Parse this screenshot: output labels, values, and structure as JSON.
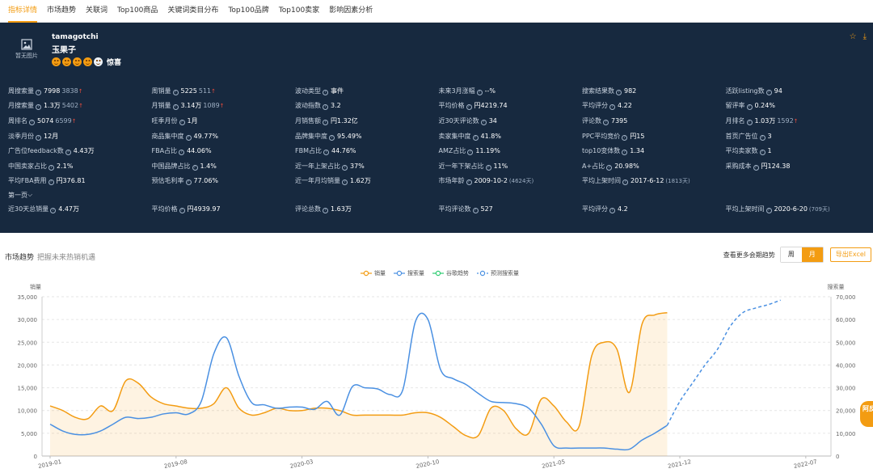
{
  "tabs": [
    "指标详情",
    "市场趋势",
    "关联词",
    "Top100商品",
    "关键词类目分布",
    "Top100品牌",
    "Top100卖家",
    "影响因素分析"
  ],
  "product": {
    "thumb_label": "暂无图片",
    "title": "tamagotchi",
    "subtitle": "玉果子",
    "emoji_text": "惊喜"
  },
  "metrics": [
    [
      {
        "label": "周搜索量",
        "value": "7998",
        "sub": "3838",
        "arrow": "↑"
      },
      {
        "label": "周销量",
        "value": "5225",
        "sub": "511",
        "arrow": "↑"
      },
      {
        "label": "波动类型",
        "value": "事件"
      },
      {
        "label": "未来3月涨幅",
        "value": "--%"
      },
      {
        "label": "搜索结果数",
        "value": "982"
      },
      {
        "label": "活跃listing数",
        "value": "94"
      }
    ],
    [
      {
        "label": "月搜索量",
        "value": "1.3万",
        "sub": "5402",
        "arrow": "↑"
      },
      {
        "label": "月销量",
        "value": "3.14万",
        "sub": "1089",
        "arrow": "↑"
      },
      {
        "label": "波动指数",
        "value": "3.2"
      },
      {
        "label": "平均价格",
        "value": "円4219.74"
      },
      {
        "label": "平均评分",
        "value": "4.22"
      },
      {
        "label": "留评率",
        "value": "0.24%"
      }
    ],
    [
      {
        "label": "周排名",
        "value": "5074",
        "sub": "6599",
        "arrow": "↑"
      },
      {
        "label": "旺季月份",
        "value": "1月"
      },
      {
        "label": "月销售额",
        "value": "円1.32亿"
      },
      {
        "label": "近30天评论数",
        "value": "34"
      },
      {
        "label": "评论数",
        "value": "7395"
      },
      {
        "label": "月排名",
        "value": "1.03万",
        "sub": "1592",
        "arrow": "↑"
      }
    ],
    [
      {
        "label": "淡季月份",
        "value": "12月"
      },
      {
        "label": "商品集中度",
        "value": "49.77%"
      },
      {
        "label": "品牌集中度",
        "value": "95.49%"
      },
      {
        "label": "卖家集中度",
        "value": "41.8%"
      },
      {
        "label": "PPC平均竞价",
        "value": "円15"
      },
      {
        "label": "首页广告位",
        "value": "3"
      }
    ],
    [
      {
        "label": "广告位feedback数",
        "value": "4.43万"
      },
      {
        "label": "FBA占比",
        "value": "44.06%"
      },
      {
        "label": "FBM占比",
        "value": "44.76%"
      },
      {
        "label": "AMZ占比",
        "value": "11.19%"
      },
      {
        "label": "top10变体数",
        "value": "1.34"
      },
      {
        "label": "平均卖家数",
        "value": "1"
      }
    ],
    [
      {
        "label": "中国卖家占比",
        "value": "2.1%"
      },
      {
        "label": "中国品牌占比",
        "value": "1.4%"
      },
      {
        "label": "近一年上架占比",
        "value": "37%"
      },
      {
        "label": "近一年下架占比",
        "value": "11%"
      },
      {
        "label": "A+占比",
        "value": "20.98%"
      },
      {
        "label": "采购成本",
        "value": "円124.38"
      }
    ],
    [
      {
        "label": "平均FBA费用",
        "value": "円376.81"
      },
      {
        "label": "预估毛利率",
        "value": "77.06%"
      },
      {
        "label": "近一年月均销量",
        "value": "1.62万"
      },
      {
        "label": "市场年龄",
        "value": "2009-10-2",
        "small": "(4624天)"
      },
      {
        "label": "平均上架时间",
        "value": "2017-6-12",
        "small": "(1813天)"
      },
      {
        "label": "",
        "value": ""
      }
    ]
  ],
  "page_toggle": "第一页",
  "last_row": [
    {
      "label": "近30天总销量",
      "value": "4.47万"
    },
    {
      "label": "平均价格",
      "value": "円4939.97"
    },
    {
      "label": "评论总数",
      "value": "1.63万"
    },
    {
      "label": "平均评论数",
      "value": "527"
    },
    {
      "label": "平均评分",
      "value": "4.2"
    },
    {
      "label": "平均上架时间",
      "value": "2020-6-20",
      "small": "(709天)"
    }
  ],
  "market": {
    "title": "市场趋势",
    "subtitle": "把握未来热销机遇",
    "more_label": "查看更多会期趋势",
    "week": "周",
    "month": "月",
    "export": "导出Excel",
    "badge": "阿反"
  },
  "colors": {
    "sales": "#f39c12",
    "search": "#4a90e2",
    "google": "#2ecc71",
    "forecast": "#4a90e2",
    "panel": "#17293f"
  },
  "chart_data": {
    "type": "line",
    "legend": [
      "销量",
      "搜索量",
      "谷歌趋势",
      "预测搜索量"
    ],
    "ylabel_left": "销量",
    "ylabel_right": "搜索量",
    "ylim_left": [
      0,
      35000
    ],
    "ylim_right": [
      0,
      70000
    ],
    "yticks_left": [
      "0",
      "5,000",
      "10,000",
      "15,000",
      "20,000",
      "25,000",
      "30,000",
      "35,000"
    ],
    "yticks_right": [
      "0",
      "10,000",
      "20,000",
      "30,000",
      "40,000",
      "50,000",
      "60,000",
      "70,000"
    ],
    "xticks": [
      "2019-01",
      "2019-08",
      "2020-03",
      "2020-10",
      "2021-05",
      "2021-12",
      "2022-07"
    ],
    "sales": [
      [
        0,
        11000
      ],
      [
        1,
        10000
      ],
      [
        2,
        8500
      ],
      [
        3,
        8200
      ],
      [
        4,
        11000
      ],
      [
        5,
        10000
      ],
      [
        6,
        16500
      ],
      [
        7,
        16000
      ],
      [
        8,
        13000
      ],
      [
        9,
        11500
      ],
      [
        10,
        11000
      ],
      [
        11,
        10500
      ],
      [
        12,
        10500
      ],
      [
        13,
        11500
      ],
      [
        14,
        15000
      ],
      [
        15,
        10500
      ],
      [
        16,
        9000
      ],
      [
        17,
        9500
      ],
      [
        18,
        10500
      ],
      [
        19,
        10000
      ],
      [
        20,
        10000
      ],
      [
        21,
        10500
      ],
      [
        22,
        10500
      ],
      [
        23,
        10000
      ],
      [
        24,
        9000
      ],
      [
        25,
        9000
      ],
      [
        26,
        9000
      ],
      [
        27,
        9000
      ],
      [
        28,
        9000
      ],
      [
        29,
        9500
      ],
      [
        30,
        9500
      ],
      [
        31,
        8500
      ],
      [
        32,
        6500
      ],
      [
        33,
        4500
      ],
      [
        34,
        4500
      ],
      [
        35,
        10500
      ],
      [
        36,
        10000
      ],
      [
        37,
        6000
      ],
      [
        38,
        5000
      ],
      [
        39,
        12500
      ],
      [
        40,
        11000
      ],
      [
        41,
        7500
      ],
      [
        42,
        6500
      ],
      [
        43,
        22000
      ],
      [
        44,
        25000
      ],
      [
        45,
        23500
      ],
      [
        46,
        14000
      ],
      [
        47,
        29000
      ],
      [
        48,
        31000
      ],
      [
        49,
        31500
      ]
    ],
    "search": [
      [
        0,
        14000
      ],
      [
        1,
        11000
      ],
      [
        2,
        9500
      ],
      [
        3,
        9500
      ],
      [
        4,
        11000
      ],
      [
        5,
        14000
      ],
      [
        6,
        17000
      ],
      [
        7,
        16500
      ],
      [
        8,
        17000
      ],
      [
        9,
        18500
      ],
      [
        10,
        19000
      ],
      [
        11,
        18500
      ],
      [
        12,
        24000
      ],
      [
        13,
        45000
      ],
      [
        14,
        52000
      ],
      [
        15,
        35000
      ],
      [
        16,
        23500
      ],
      [
        17,
        22500
      ],
      [
        18,
        21000
      ],
      [
        19,
        21500
      ],
      [
        20,
        21500
      ],
      [
        21,
        20500
      ],
      [
        22,
        24000
      ],
      [
        23,
        18000
      ],
      [
        24,
        30500
      ],
      [
        25,
        30000
      ],
      [
        26,
        29500
      ],
      [
        27,
        27000
      ],
      [
        28,
        29000
      ],
      [
        29,
        59000
      ],
      [
        30,
        60000
      ],
      [
        31,
        38000
      ],
      [
        32,
        34000
      ],
      [
        33,
        31500
      ],
      [
        34,
        27500
      ],
      [
        35,
        24000
      ],
      [
        36,
        23500
      ],
      [
        37,
        23000
      ],
      [
        38,
        21000
      ],
      [
        39,
        14000
      ],
      [
        40,
        4500
      ],
      [
        41,
        3500
      ],
      [
        42,
        3500
      ],
      [
        43,
        3500
      ],
      [
        44,
        3500
      ],
      [
        45,
        3000
      ],
      [
        46,
        3000
      ],
      [
        47,
        7000
      ],
      [
        48,
        10000
      ],
      [
        49,
        13500
      ]
    ],
    "forecast": [
      [
        49,
        13500
      ],
      [
        50,
        24000
      ],
      [
        51,
        32000
      ],
      [
        52,
        40000
      ],
      [
        53,
        47000
      ],
      [
        54,
        57000
      ],
      [
        55,
        63000
      ],
      [
        56,
        65000
      ],
      [
        57,
        66500
      ],
      [
        58,
        68500
      ]
    ]
  }
}
